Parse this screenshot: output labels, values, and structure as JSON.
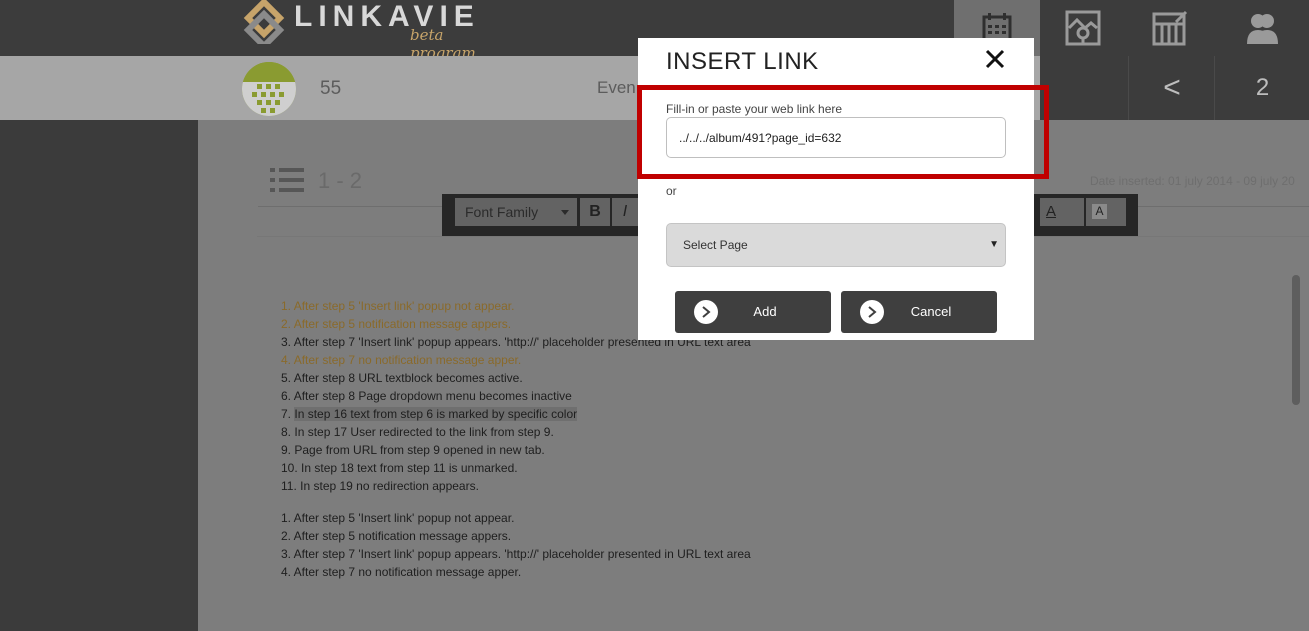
{
  "header": {
    "logo_text": "LINKAVIE",
    "logo_sub": "beta program",
    "nav_icons": [
      "calendar-icon",
      "picture-pin-icon",
      "shelves-edit-icon",
      "users-icon"
    ]
  },
  "subbar": {
    "count": "55",
    "event_label": "Even",
    "prev_symbol": "<",
    "page_number": "2"
  },
  "content": {
    "range": "1 - 2",
    "date_range": "Date inserted: 01 july 2014 - 09 july 20",
    "toolbar": {
      "font_family": "Font Family",
      "bold": "B",
      "italic": "I",
      "text_color": "A",
      "bg_color": "A"
    },
    "lines": [
      {
        "num": "1.",
        "text": "After step 5 'Insert link' popup not appear.",
        "style": "orange"
      },
      {
        "num": "2.",
        "text": "After step 5 notification message appers.",
        "style": "orange"
      },
      {
        "num": "3.",
        "text": "After step 7 'Insert link' popup appears. 'http://' placeholder presented in URL text area",
        "style": "normal"
      },
      {
        "num": "4.",
        "text": "After step 7 no notification message apper.",
        "style": "orange"
      },
      {
        "num": "5.",
        "text": "After step 8 URL textblock becomes active.",
        "style": "normal"
      },
      {
        "num": "6.",
        "text": "After step 8 Page dropdown menu becomes inactive",
        "style": "normal"
      },
      {
        "num": "7.",
        "text": "In step 16 text from step 6 is marked by specific color",
        "style": "highlight"
      },
      {
        "num": "8.",
        "text": "In step 17 User redirected to the link from step 9.",
        "style": "normal"
      },
      {
        "num": "9.",
        "text": "Page from URL from step 9 opened in new tab.",
        "style": "normal"
      },
      {
        "num": "10.",
        "text": "In step 18 text from step 11 is unmarked.",
        "style": "normal"
      },
      {
        "num": "11.",
        "text": "In step 19 no redirection appears.",
        "style": "normal"
      }
    ],
    "lines2": [
      "1. After step 5 'Insert link' popup not appear.",
      "2. After step 5 notification message appers.",
      "3. After step 7 'Insert link' popup appears. 'http://' placeholder presented in URL text area",
      "4. After step 7 no notification message apper."
    ]
  },
  "modal": {
    "title": "INSERT LINK",
    "close_symbol": "✕",
    "field_label": "Fill-in or paste your web link here",
    "url_value": "../../../album/491?page_id=632",
    "or_label": "or",
    "select_value": "Select Page",
    "add_label": "Add",
    "cancel_label": "Cancel"
  },
  "colors": {
    "highlight_border": "#c00000",
    "avatar": "#8a9b31",
    "logo_accent": "#c7a46a"
  }
}
